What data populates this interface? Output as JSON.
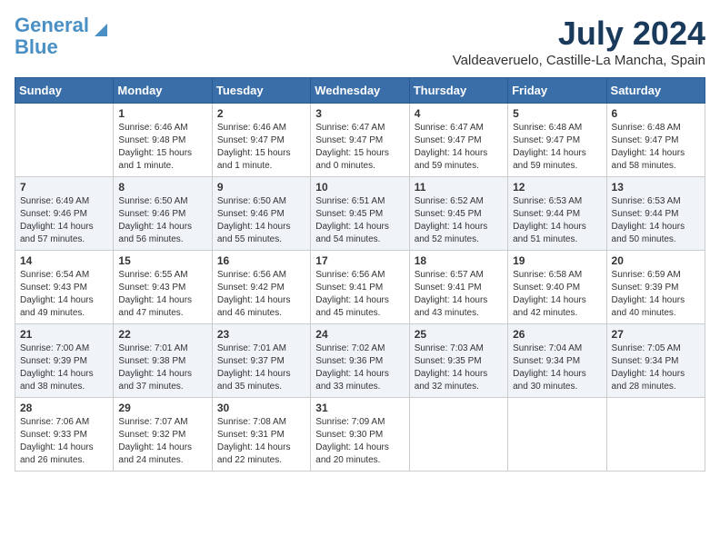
{
  "header": {
    "logo_line1": "General",
    "logo_line2": "Blue",
    "month": "July 2024",
    "location": "Valdeaveruelo, Castille-La Mancha, Spain"
  },
  "weekdays": [
    "Sunday",
    "Monday",
    "Tuesday",
    "Wednesday",
    "Thursday",
    "Friday",
    "Saturday"
  ],
  "weeks": [
    [
      {
        "day": "",
        "data": ""
      },
      {
        "day": "1",
        "data": "Sunrise: 6:46 AM\nSunset: 9:48 PM\nDaylight: 15 hours\nand 1 minute."
      },
      {
        "day": "2",
        "data": "Sunrise: 6:46 AM\nSunset: 9:47 PM\nDaylight: 15 hours\nand 1 minute."
      },
      {
        "day": "3",
        "data": "Sunrise: 6:47 AM\nSunset: 9:47 PM\nDaylight: 15 hours\nand 0 minutes."
      },
      {
        "day": "4",
        "data": "Sunrise: 6:47 AM\nSunset: 9:47 PM\nDaylight: 14 hours\nand 59 minutes."
      },
      {
        "day": "5",
        "data": "Sunrise: 6:48 AM\nSunset: 9:47 PM\nDaylight: 14 hours\nand 59 minutes."
      },
      {
        "day": "6",
        "data": "Sunrise: 6:48 AM\nSunset: 9:47 PM\nDaylight: 14 hours\nand 58 minutes."
      }
    ],
    [
      {
        "day": "7",
        "data": "Sunrise: 6:49 AM\nSunset: 9:46 PM\nDaylight: 14 hours\nand 57 minutes."
      },
      {
        "day": "8",
        "data": "Sunrise: 6:50 AM\nSunset: 9:46 PM\nDaylight: 14 hours\nand 56 minutes."
      },
      {
        "day": "9",
        "data": "Sunrise: 6:50 AM\nSunset: 9:46 PM\nDaylight: 14 hours\nand 55 minutes."
      },
      {
        "day": "10",
        "data": "Sunrise: 6:51 AM\nSunset: 9:45 PM\nDaylight: 14 hours\nand 54 minutes."
      },
      {
        "day": "11",
        "data": "Sunrise: 6:52 AM\nSunset: 9:45 PM\nDaylight: 14 hours\nand 52 minutes."
      },
      {
        "day": "12",
        "data": "Sunrise: 6:53 AM\nSunset: 9:44 PM\nDaylight: 14 hours\nand 51 minutes."
      },
      {
        "day": "13",
        "data": "Sunrise: 6:53 AM\nSunset: 9:44 PM\nDaylight: 14 hours\nand 50 minutes."
      }
    ],
    [
      {
        "day": "14",
        "data": "Sunrise: 6:54 AM\nSunset: 9:43 PM\nDaylight: 14 hours\nand 49 minutes."
      },
      {
        "day": "15",
        "data": "Sunrise: 6:55 AM\nSunset: 9:43 PM\nDaylight: 14 hours\nand 47 minutes."
      },
      {
        "day": "16",
        "data": "Sunrise: 6:56 AM\nSunset: 9:42 PM\nDaylight: 14 hours\nand 46 minutes."
      },
      {
        "day": "17",
        "data": "Sunrise: 6:56 AM\nSunset: 9:41 PM\nDaylight: 14 hours\nand 45 minutes."
      },
      {
        "day": "18",
        "data": "Sunrise: 6:57 AM\nSunset: 9:41 PM\nDaylight: 14 hours\nand 43 minutes."
      },
      {
        "day": "19",
        "data": "Sunrise: 6:58 AM\nSunset: 9:40 PM\nDaylight: 14 hours\nand 42 minutes."
      },
      {
        "day": "20",
        "data": "Sunrise: 6:59 AM\nSunset: 9:39 PM\nDaylight: 14 hours\nand 40 minutes."
      }
    ],
    [
      {
        "day": "21",
        "data": "Sunrise: 7:00 AM\nSunset: 9:39 PM\nDaylight: 14 hours\nand 38 minutes."
      },
      {
        "day": "22",
        "data": "Sunrise: 7:01 AM\nSunset: 9:38 PM\nDaylight: 14 hours\nand 37 minutes."
      },
      {
        "day": "23",
        "data": "Sunrise: 7:01 AM\nSunset: 9:37 PM\nDaylight: 14 hours\nand 35 minutes."
      },
      {
        "day": "24",
        "data": "Sunrise: 7:02 AM\nSunset: 9:36 PM\nDaylight: 14 hours\nand 33 minutes."
      },
      {
        "day": "25",
        "data": "Sunrise: 7:03 AM\nSunset: 9:35 PM\nDaylight: 14 hours\nand 32 minutes."
      },
      {
        "day": "26",
        "data": "Sunrise: 7:04 AM\nSunset: 9:34 PM\nDaylight: 14 hours\nand 30 minutes."
      },
      {
        "day": "27",
        "data": "Sunrise: 7:05 AM\nSunset: 9:34 PM\nDaylight: 14 hours\nand 28 minutes."
      }
    ],
    [
      {
        "day": "28",
        "data": "Sunrise: 7:06 AM\nSunset: 9:33 PM\nDaylight: 14 hours\nand 26 minutes."
      },
      {
        "day": "29",
        "data": "Sunrise: 7:07 AM\nSunset: 9:32 PM\nDaylight: 14 hours\nand 24 minutes."
      },
      {
        "day": "30",
        "data": "Sunrise: 7:08 AM\nSunset: 9:31 PM\nDaylight: 14 hours\nand 22 minutes."
      },
      {
        "day": "31",
        "data": "Sunrise: 7:09 AM\nSunset: 9:30 PM\nDaylight: 14 hours\nand 20 minutes."
      },
      {
        "day": "",
        "data": ""
      },
      {
        "day": "",
        "data": ""
      },
      {
        "day": "",
        "data": ""
      }
    ]
  ]
}
